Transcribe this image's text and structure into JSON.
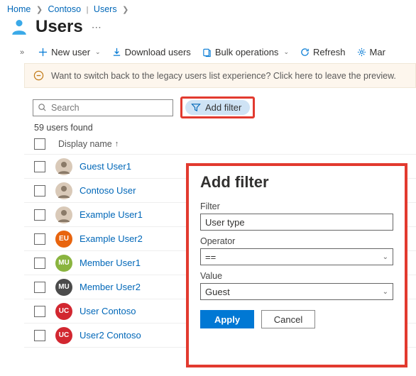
{
  "breadcrumb": {
    "home": "Home",
    "org": "Contoso",
    "section": "Users"
  },
  "title": "Users",
  "toolbar": {
    "new_user": "New user",
    "download": "Download users",
    "bulk": "Bulk operations",
    "refresh": "Refresh",
    "manage": "Mar"
  },
  "banner": "Want to switch back to the legacy users list experience? Click here to leave the preview.",
  "search": {
    "placeholder": "Search"
  },
  "add_filter_label": "Add filter",
  "count_text": "59 users found",
  "header_col": "Display name",
  "users": [
    {
      "name": "Guest User1",
      "initials": "",
      "bg": "#ffffff",
      "img": true
    },
    {
      "name": "Contoso User",
      "initials": "",
      "bg": "#ffffff",
      "img": true
    },
    {
      "name": "Example User1",
      "initials": "",
      "bg": "#ffffff",
      "img": true
    },
    {
      "name": "Example User2",
      "initials": "EU",
      "bg": "#e8640e",
      "img": false
    },
    {
      "name": "Member User1",
      "initials": "MU",
      "bg": "#8ab43f",
      "img": false
    },
    {
      "name": "Member User2",
      "initials": "MU",
      "bg": "#4b4b4b",
      "img": false
    },
    {
      "name": "User Contoso",
      "initials": "UC",
      "bg": "#d22730",
      "img": false
    },
    {
      "name": "User2 Contoso",
      "initials": "UC",
      "bg": "#d22730",
      "img": false
    }
  ],
  "panel": {
    "title": "Add filter",
    "filter_label": "Filter",
    "filter_value": "User type",
    "op_label": "Operator",
    "op_value": "==",
    "val_label": "Value",
    "val_value": "Guest",
    "apply": "Apply",
    "cancel": "Cancel"
  }
}
